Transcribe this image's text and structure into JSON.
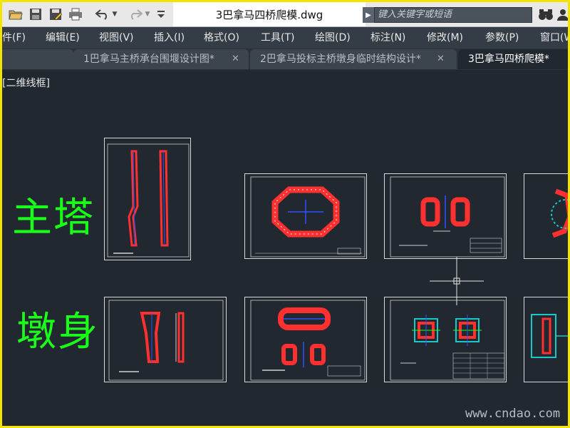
{
  "titlebar": {
    "document_title": "3巴拿马四桥爬模.dwg",
    "search_placeholder": "键入关键字或短语",
    "quick_access_icons": [
      "open-icon",
      "save-icon",
      "save-as-icon",
      "print-icon",
      "undo-icon",
      "undo-dropdown-icon",
      "redo-icon",
      "redo-dropdown-icon",
      "customize-dropdown-icon"
    ],
    "right_icons": [
      "binoculars-icon",
      "user-icon"
    ]
  },
  "menu": {
    "items": [
      "件(F)",
      "编辑(E)",
      "视图(V)",
      "插入(I)",
      "格式(O)",
      "工具(T)",
      "绘图(D)",
      "标注(N)",
      "修改(M)",
      "参数(P)",
      "窗口(W"
    ]
  },
  "tabs": [
    {
      "label": "1巴拿马主桥承台围堰设计图*",
      "active": false
    },
    {
      "label": "2巴拿马投标主桥墩身临时结构设计*",
      "active": false
    },
    {
      "label": "3巴拿马四桥爬模*",
      "active": true
    }
  ],
  "canvas": {
    "viewport_label": "[二维线框]",
    "labels": {
      "tower": "主塔",
      "pier": "墩身"
    },
    "watermark": "www.cndao.com"
  },
  "colors": {
    "border": "#f5e400",
    "canvas_bg": "#212830",
    "label_green": "#19ff19",
    "drawing_red": "#ff3030",
    "drawing_blue": "#3050ff",
    "sheet_border": "#d9d9d9"
  }
}
